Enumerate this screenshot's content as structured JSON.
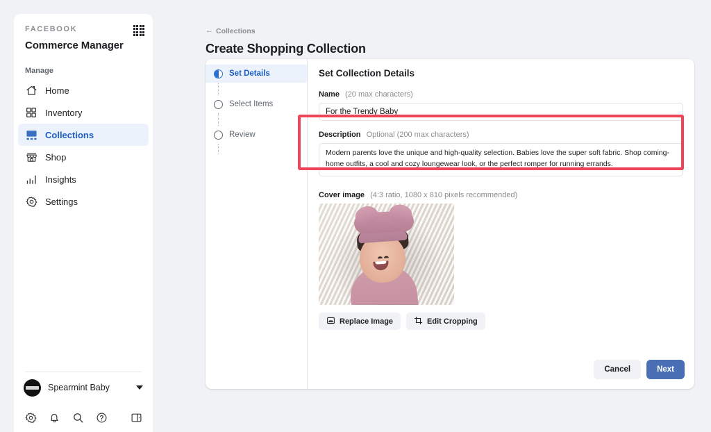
{
  "sidebar": {
    "brand": "FACEBOOK",
    "title": "Commerce Manager",
    "apps_icon": "apps-grid-icon",
    "section_label": "Manage",
    "items": [
      {
        "label": "Home",
        "icon": "home-icon",
        "active": false
      },
      {
        "label": "Inventory",
        "icon": "inventory-grid-icon",
        "active": false
      },
      {
        "label": "Collections",
        "icon": "collections-icon",
        "active": true
      },
      {
        "label": "Shop",
        "icon": "storefront-icon",
        "active": false
      },
      {
        "label": "Insights",
        "icon": "bar-chart-icon",
        "active": false
      },
      {
        "label": "Settings",
        "icon": "gear-icon",
        "active": false
      }
    ],
    "account": {
      "name": "Spearmint Baby",
      "avatar_icon": "avatar",
      "caret_icon": "chevron-down-icon"
    },
    "tools": [
      {
        "name": "gear-icon"
      },
      {
        "name": "bell-icon"
      },
      {
        "name": "search-icon"
      },
      {
        "name": "help-icon"
      },
      {
        "name": "panel-toggle-icon"
      }
    ]
  },
  "header": {
    "breadcrumb_arrow": "←",
    "breadcrumb": "Collections",
    "title": "Create Shopping Collection"
  },
  "steps": [
    {
      "label": "Set Details",
      "state": "in-progress"
    },
    {
      "label": "Select Items",
      "state": "pending"
    },
    {
      "label": "Review",
      "state": "pending"
    }
  ],
  "form": {
    "panel_title": "Set Collection Details",
    "name": {
      "label": "Name",
      "hint": "(20 max characters)",
      "value": "For the Trendy Baby",
      "placeholder": "Name"
    },
    "description": {
      "label": "Description",
      "hint": "Optional (200 max characters)",
      "value": "Modern parents love the unique and high-quality selection. Babies love the super soft fabric. Shop coming-home outfits, a cool and cozy loungewear look, or the perfect romper for running errands.",
      "placeholder": "Description"
    },
    "cover_image": {
      "label": "Cover image",
      "hint": "(4:3 ratio, 1080 x 810 pixels recommended)",
      "replace_label": "Replace Image",
      "replace_icon": "photo-icon",
      "crop_label": "Edit Cropping",
      "crop_icon": "crop-icon"
    }
  },
  "footer": {
    "cancel_label": "Cancel",
    "next_label": "Next"
  },
  "colors": {
    "accent_blue": "#4a6fb5",
    "active_blue": "#1f5fc4",
    "highlight_red": "#ef4559",
    "page_bg": "#f0f2f5"
  }
}
